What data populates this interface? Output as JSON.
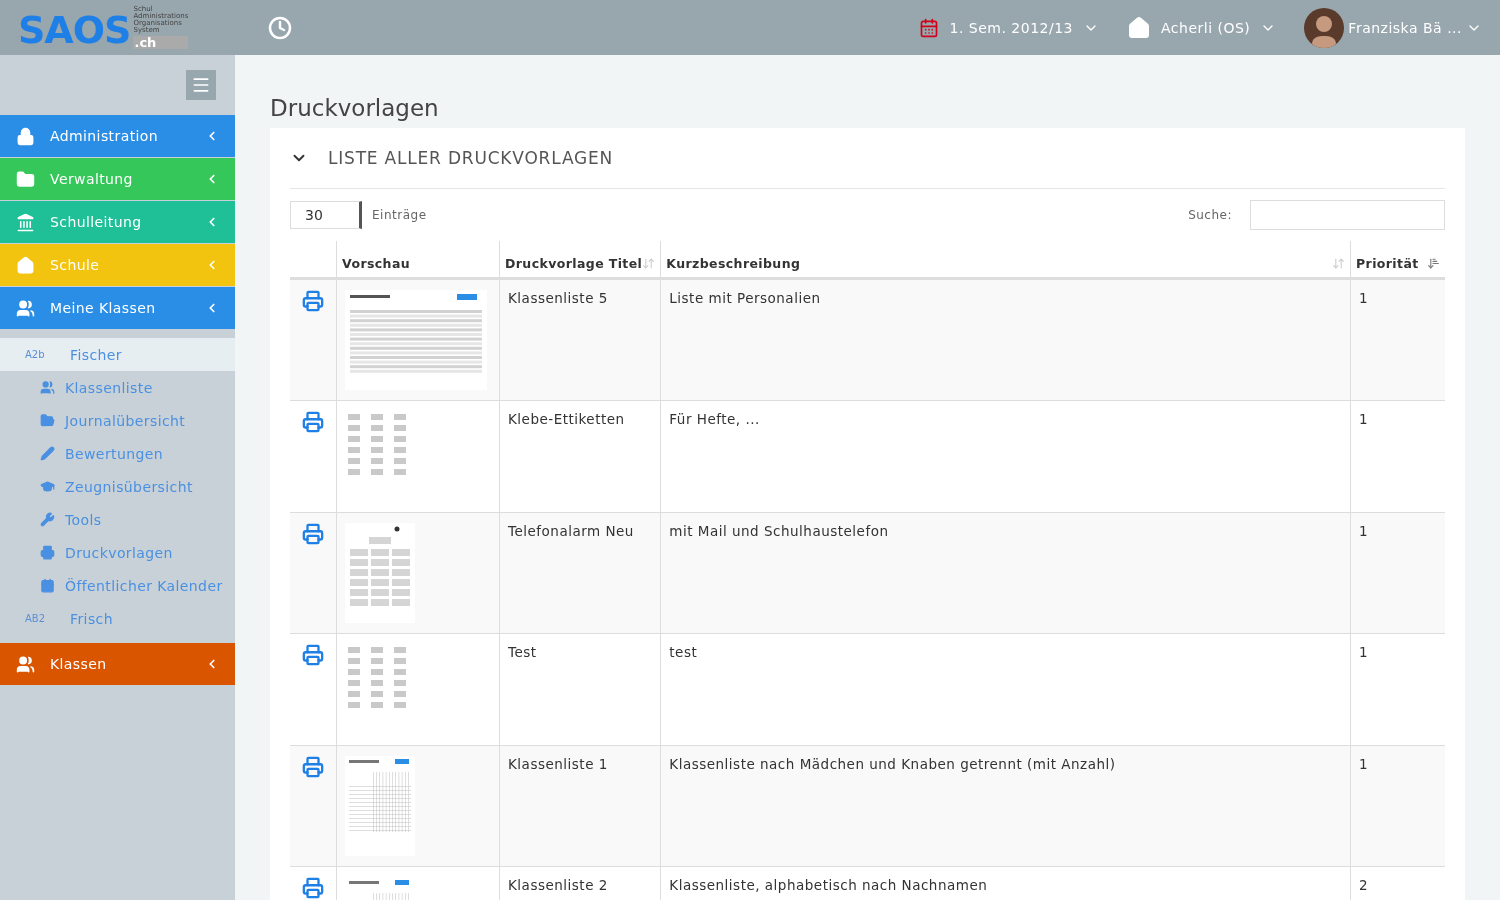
{
  "logo": {
    "name": "SAOS",
    "tagline": [
      "Schul",
      "Administrations",
      "Organisations",
      "System"
    ],
    "domain": ".ch"
  },
  "topbar": {
    "semester": "1. Sem. 2012/13",
    "school": "Acherli (OS)",
    "user": "Franziska Bä ..."
  },
  "nav": {
    "items": [
      {
        "label": "Administration",
        "color": "#2b8ee6"
      },
      {
        "label": "Verwaltung",
        "color": "#35c75a"
      },
      {
        "label": "Schulleitung",
        "color": "#1fbf98"
      },
      {
        "label": "Schule",
        "color": "#f2c40f"
      },
      {
        "label": "Meine Klassen",
        "color": "#2b8ee6",
        "classes": [
          {
            "code": "A2b",
            "name": "Fischer",
            "selected": true,
            "links": [
              "Klassenliste",
              "Journalübersicht",
              "Bewertungen",
              "Zeugnisübersicht",
              "Tools",
              "Druckvorlagen",
              "Öffentlicher Kalender"
            ]
          },
          {
            "code": "AB2",
            "name": "Frisch",
            "selected": false
          }
        ]
      },
      {
        "label": "Klassen",
        "color": "#d95500"
      }
    ]
  },
  "page": {
    "title": "Druckvorlagen",
    "panel_title": "LISTE ALLER DRUCKVORLAGEN",
    "page_size": "30",
    "page_size_label": "Einträge",
    "search_label": "Suche:"
  },
  "table": {
    "columns": [
      {
        "label": "Vorschau",
        "sortable": false
      },
      {
        "label": "Druckvorlage Titel",
        "sortable": true,
        "sorted": false
      },
      {
        "label": "Kurzbeschreibung",
        "sortable": true,
        "sorted": false
      },
      {
        "label": "Priorität",
        "sortable": true,
        "sorted": true
      }
    ],
    "rows": [
      {
        "preview": {
          "kind": "table"
        },
        "title": "Klassenliste 5",
        "description": "Liste mit Personalien",
        "priority": "1"
      },
      {
        "preview": {
          "kind": "labels"
        },
        "title": "Klebe-Ettiketten",
        "description": "Für Hefte, ...",
        "priority": "1"
      },
      {
        "preview": {
          "kind": "tree"
        },
        "title": "Telefonalarm Neu",
        "description": "mit Mail und Schulhaustelefon",
        "priority": "1"
      },
      {
        "preview": {
          "kind": "labels"
        },
        "title": "Test",
        "description": "test",
        "priority": "1"
      },
      {
        "preview": {
          "kind": "grid"
        },
        "title": "Klassenliste 1",
        "description": "Klassenliste nach Mädchen und Knaben getrennt (mit Anzahl)",
        "priority": "1"
      },
      {
        "preview": {
          "kind": "grid"
        },
        "title": "Klassenliste 2",
        "description": "Klassenliste, alphabetisch nach Nachnamen",
        "priority": "2"
      }
    ]
  }
}
